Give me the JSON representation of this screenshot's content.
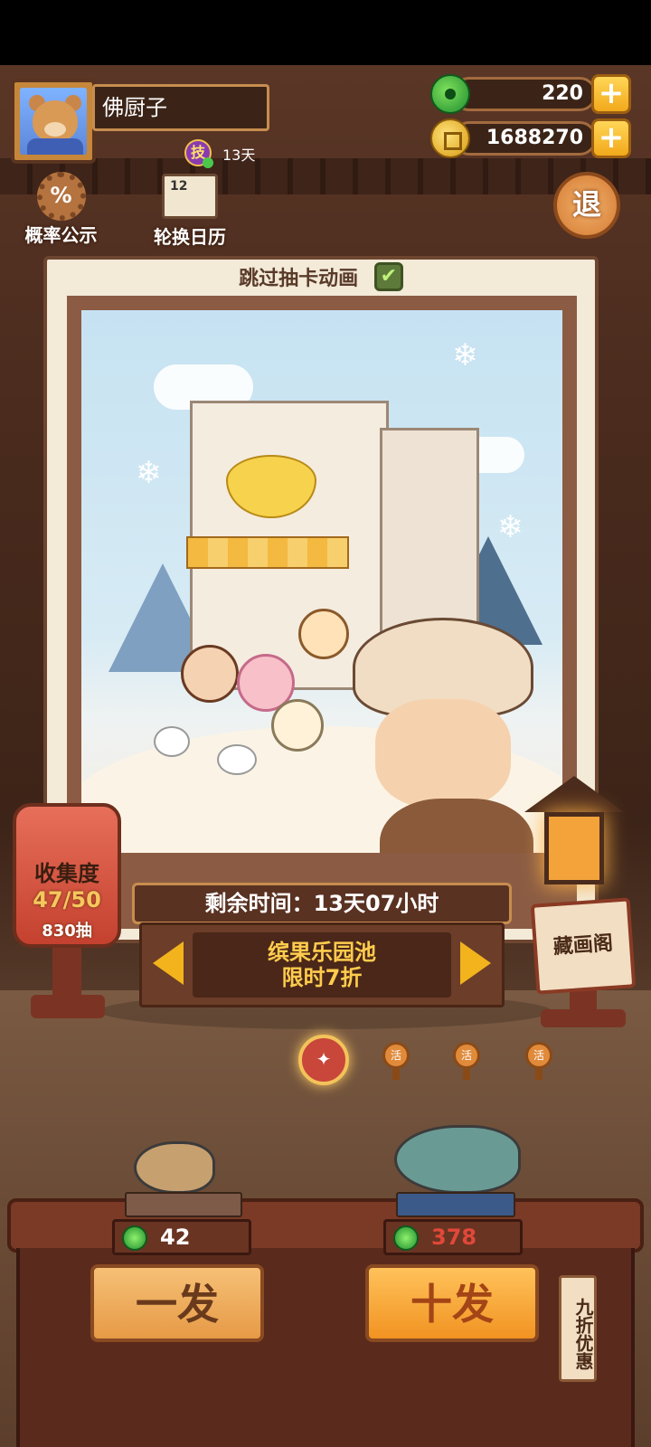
{
  "player": {
    "name": "佛厨子",
    "skill_badge": "技",
    "skill_days": "13天"
  },
  "currency": {
    "jade": "220",
    "coins": "1688270",
    "plus": "+"
  },
  "top_buttons": {
    "probability_icon": "%",
    "probability_label": "概率公示",
    "calendar_icon_text": "12",
    "calendar_label": "轮换日历",
    "exit_label": "退"
  },
  "card": {
    "skip_label": "跳过抽卡动画",
    "skip_checked": true,
    "check_mark": "✔"
  },
  "collection": {
    "title": "收集度",
    "progress": "47/50",
    "draws": "830抽"
  },
  "gallery_label": "藏画阁",
  "pool": {
    "remaining_time": "剩余时间：13天07小时",
    "name": "缤果乐园池",
    "promo": "限时7折"
  },
  "pager": {
    "active_index": 0,
    "count": 4,
    "active_icon": "✦",
    "bell_text": "活"
  },
  "draw": {
    "single_cost": "42",
    "ten_cost": "378",
    "single_label": "一发",
    "ten_label": "十发",
    "discount_tag": "九折优惠"
  },
  "colors": {
    "accent_gold": "#f2b31c",
    "jade_green": "#1f8d2e",
    "ten_cost_red": "#e0483a",
    "single_cost_white": "#ffffff"
  },
  "icons": [
    "jade-icon",
    "coin-icon",
    "plus-icon",
    "gear-icon",
    "calendar-icon",
    "exit-icon",
    "check-icon",
    "lantern-icon",
    "arrow-left-icon",
    "arrow-right-icon",
    "bell-icon"
  ]
}
